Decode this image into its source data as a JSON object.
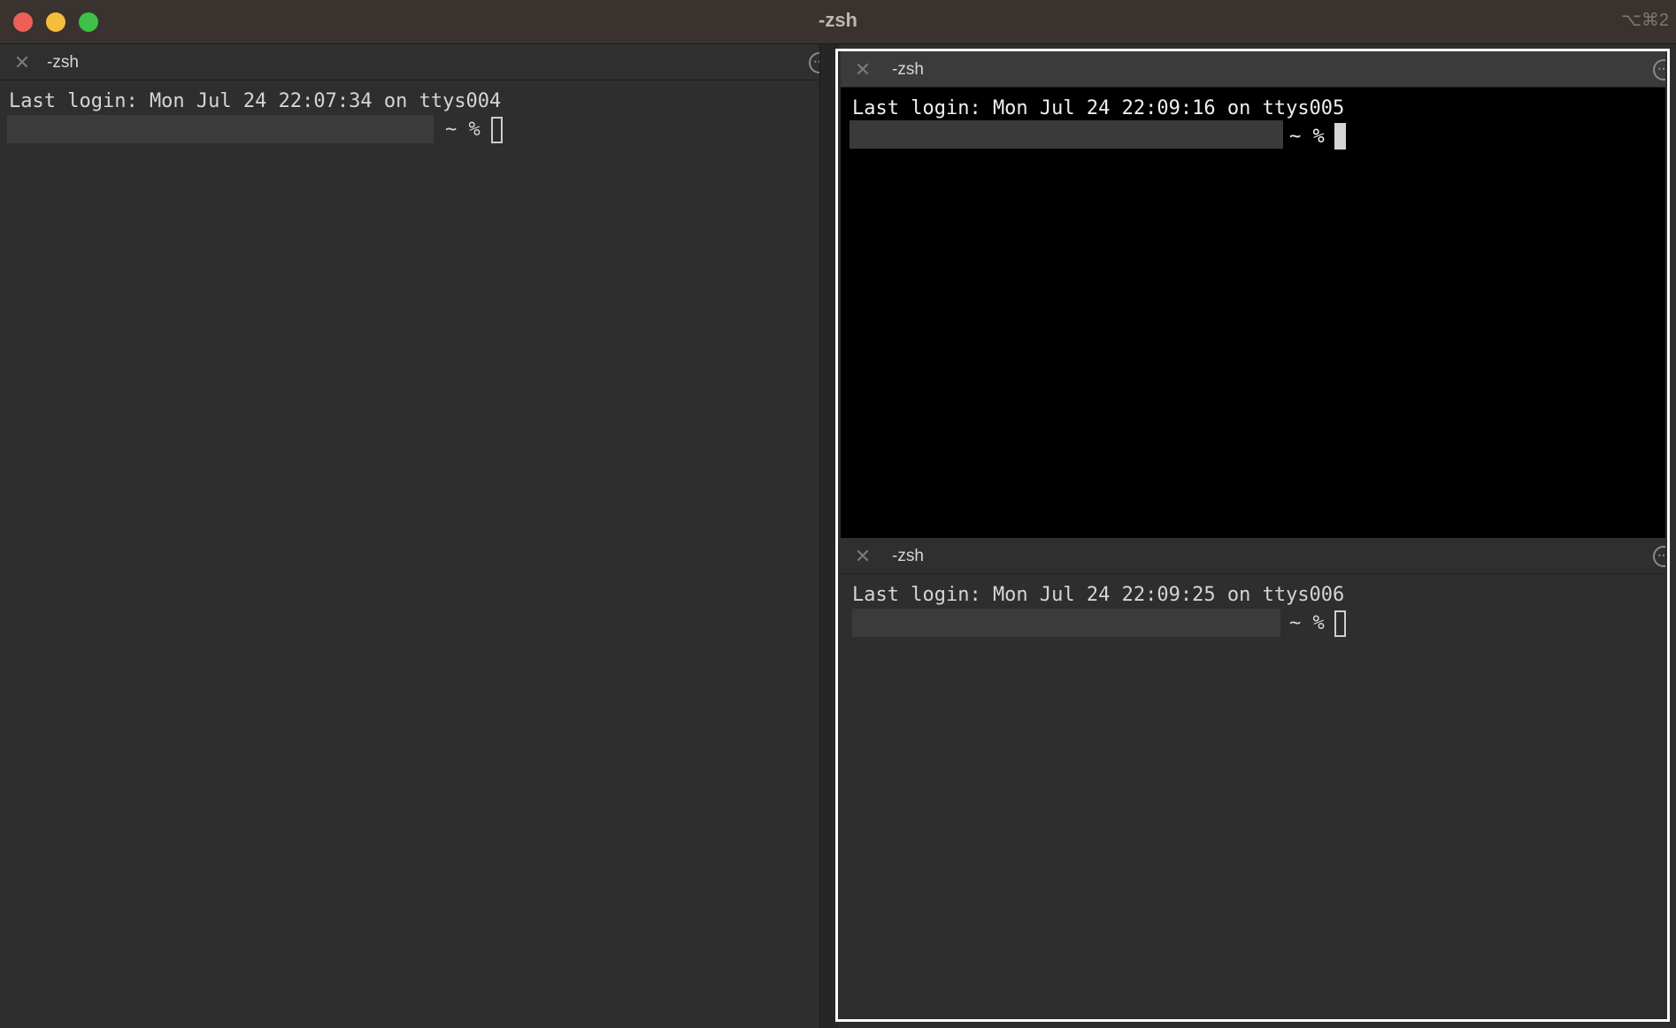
{
  "window": {
    "title": "-zsh",
    "shortcut": "⌥⌘2"
  },
  "panes": {
    "left": {
      "title": "-zsh",
      "login_line": "Last login: Mon Jul 24 22:07:34 on ttys004",
      "prompt": "~ %"
    },
    "top_right": {
      "title": "-zsh",
      "login_line": "Last login: Mon Jul 24 22:09:16 on ttys005",
      "prompt": "~ %"
    },
    "bottom_right": {
      "title": "-zsh",
      "login_line": "Last login: Mon Jul 24 22:09:25 on ttys006",
      "prompt": "~ %"
    }
  },
  "colors": {
    "titlebar": "#3a322f",
    "terminal_bg": "#2e2e2e",
    "active_terminal_bg": "#000000",
    "highlight_border": "#ffffff"
  },
  "icons": {
    "close": "close-icon",
    "more": "more-options-icon"
  }
}
